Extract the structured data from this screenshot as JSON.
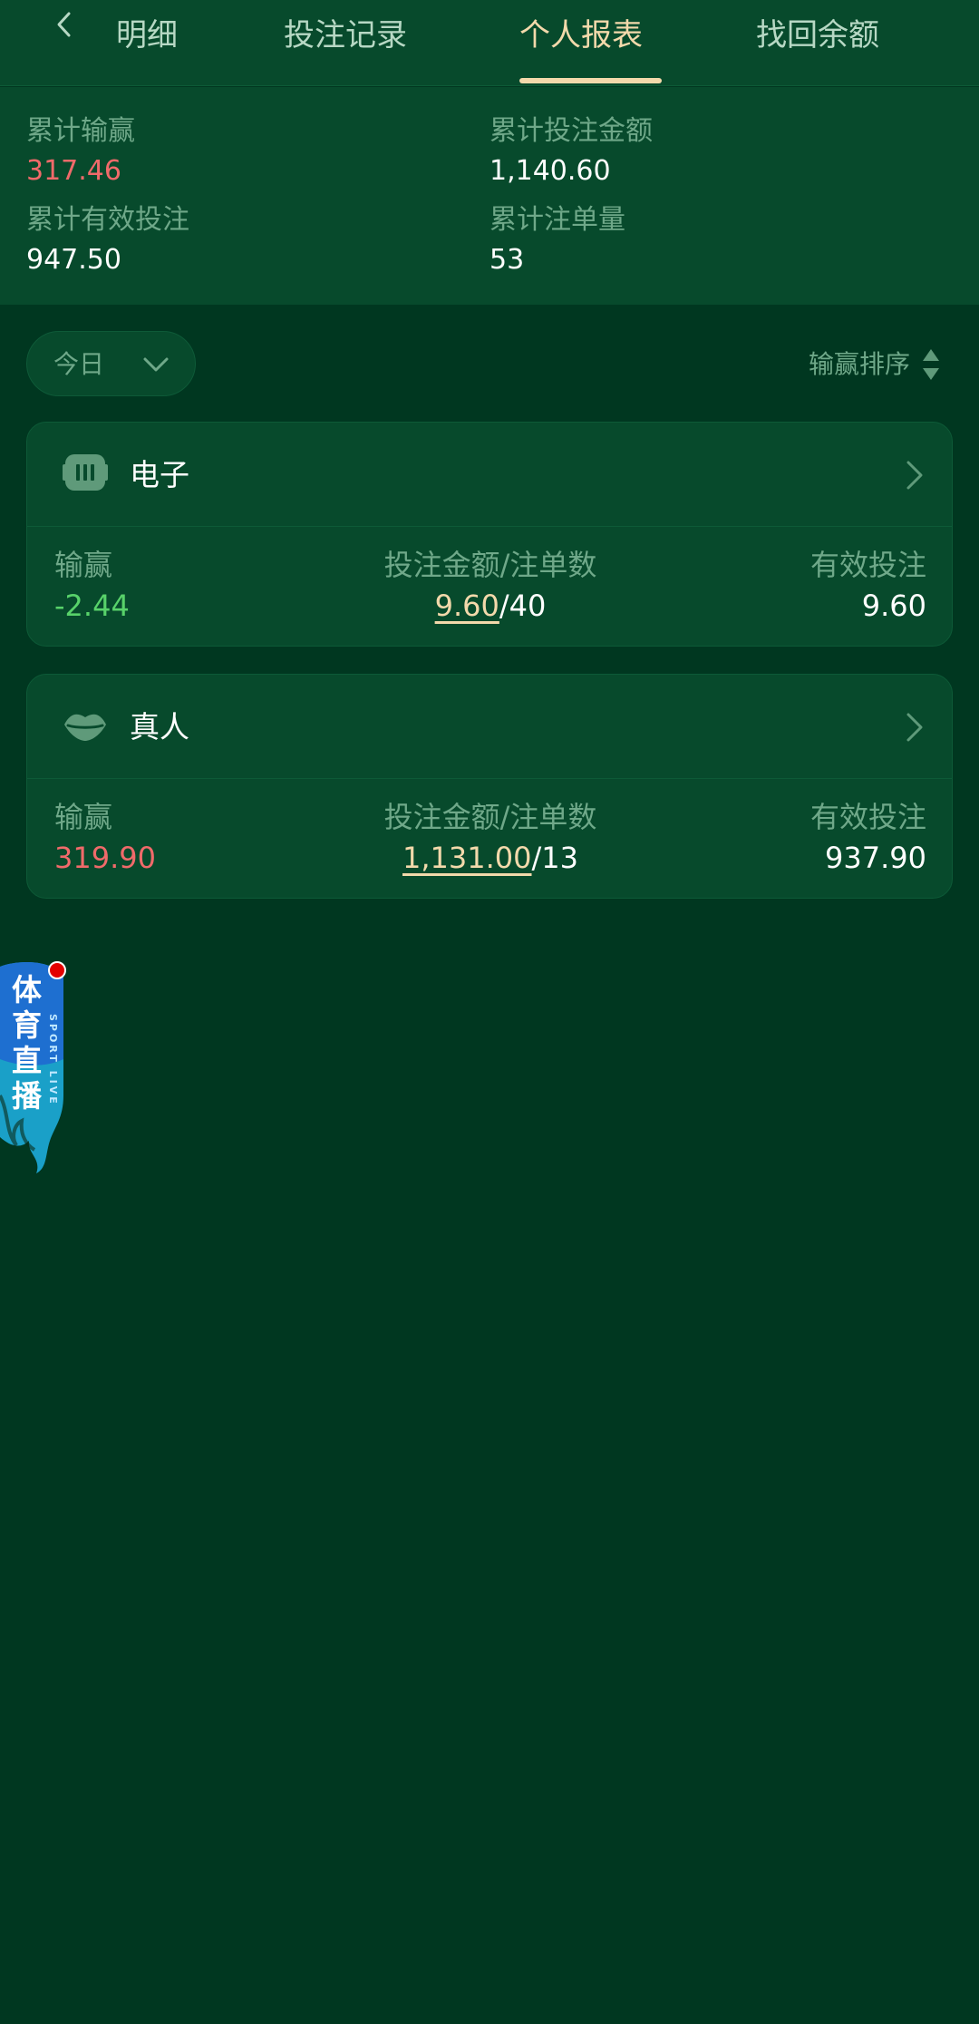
{
  "tabs": [
    {
      "label": "明细"
    },
    {
      "label": "投注记录"
    },
    {
      "label": "个人报表"
    },
    {
      "label": "找回余额"
    }
  ],
  "summary": {
    "total_win_loss_label": "累计输赢",
    "total_win_loss_value": "317.46",
    "total_bet_amount_label": "累计投注金额",
    "total_bet_amount_value": "1,140.60",
    "total_valid_bet_label": "累计有效投注",
    "total_valid_bet_value": "947.50",
    "total_order_count_label": "累计注单量",
    "total_order_count_value": "53"
  },
  "filter": {
    "period": "今日",
    "sort_label": "输赢排序"
  },
  "cards": [
    {
      "title": "电子",
      "icon": "slot-machine-icon",
      "win_loss_label": "输赢",
      "win_loss_value": "-2.44",
      "bet_label": "投注金额/注单数",
      "bet_amount": "9.60",
      "bet_count": "/40",
      "valid_label": "有效投注",
      "valid_value": "9.60"
    },
    {
      "title": "真人",
      "icon": "lips-icon",
      "win_loss_label": "输赢",
      "win_loss_value": "319.90",
      "bet_label": "投注金额/注单数",
      "bet_amount": "1,131.00",
      "bet_count": "/13",
      "valid_label": "有效投注",
      "valid_value": "937.90"
    }
  ],
  "live_badge": {
    "title": "体育直播",
    "subtitle": "SPORT LIVE"
  },
  "colors": {
    "background": "#003720",
    "panel": "#074a2c",
    "accent": "#f3d9ab",
    "positive": "#f06a6a",
    "negative": "#58d26a",
    "muted": "#6fa889"
  }
}
